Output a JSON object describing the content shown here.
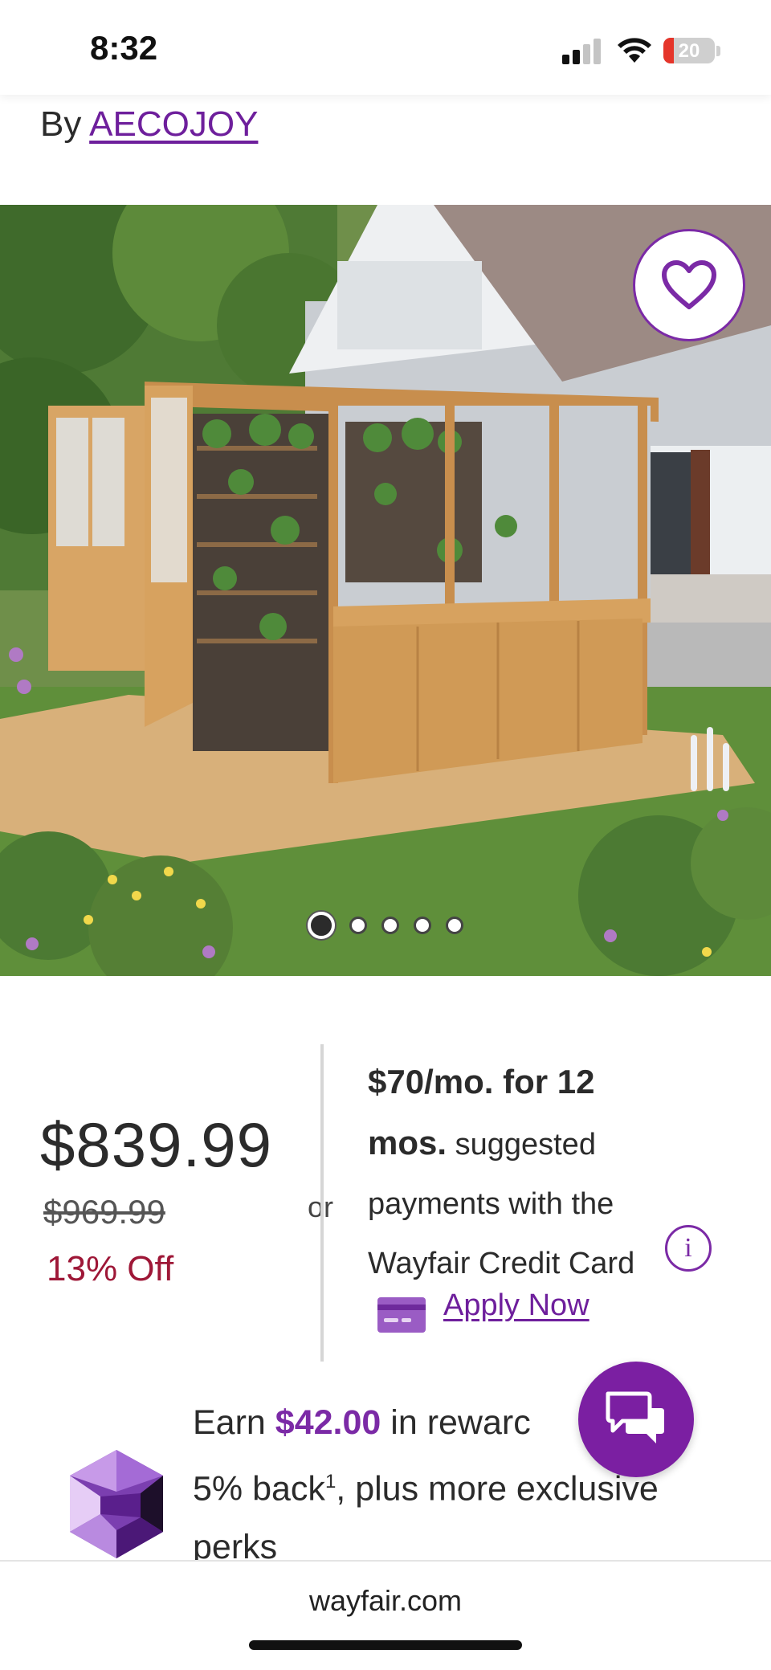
{
  "status_bar": {
    "time": "8:32",
    "battery": "20",
    "battery_level_percent": 20
  },
  "product": {
    "by_prefix": "By",
    "brand": "AECOJOY"
  },
  "gallery": {
    "image_count": 5,
    "active_index": 0
  },
  "pricing": {
    "price": "$839.99",
    "original_price": "$969.99",
    "discount": "13% Off",
    "or": "or"
  },
  "financing": {
    "line1_bold": "$70/mo. for 12",
    "line2_bold": "mos.",
    "line2_rest": "suggested",
    "line3": "payments with the",
    "line4": "Wayfair Credit Card",
    "apply_label": "Apply Now"
  },
  "rewards": {
    "earn": "Earn",
    "amount": "$42.00",
    "in_rewards": "in rewarc",
    "back": "5% back",
    "footnote": "1",
    "rest": ", plus more exclusive",
    "perks": "perks"
  },
  "browser": {
    "url": "wayfair.com"
  },
  "colors": {
    "brand_purple": "#7b1fa2",
    "link_purple": "#6e1f9c",
    "discount_red": "#9e1737"
  }
}
